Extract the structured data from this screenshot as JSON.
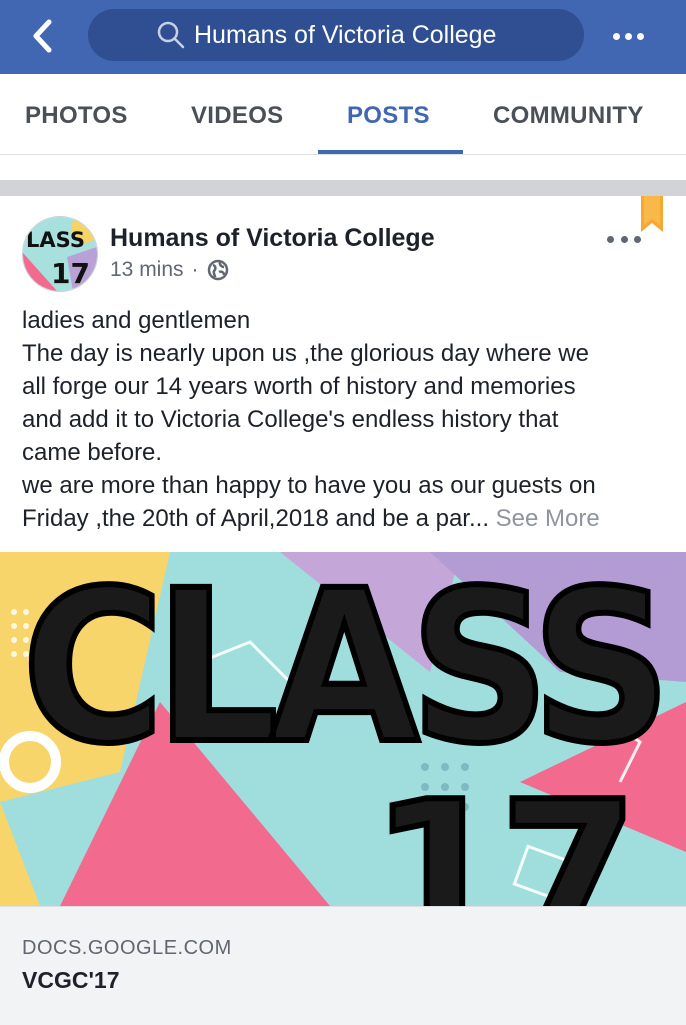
{
  "header": {
    "search_text": "Humans of Victoria College",
    "icons": {
      "back": "chevron-left-icon",
      "search": "search-icon",
      "more": "more-dots-icon"
    },
    "colors": {
      "bar": "#4267b2",
      "pill": "#2f4f92"
    }
  },
  "tabs": [
    {
      "label": "PHOTOS"
    },
    {
      "label": "VIDEOS"
    },
    {
      "label": "POSTS",
      "active": true
    },
    {
      "label": "COMMUNITY"
    }
  ],
  "post": {
    "page_name": "Humans of Victoria College",
    "time": "13 mins",
    "separator": "·",
    "privacy_icon": "globe-icon",
    "text_lines": [
      "ladies and gentlemen",
      "The day is nearly upon us ,the glorious day where we",
      "all forge our 14 years worth of history and memories",
      "and add it to Victoria College's endless history that",
      "came before.",
      "we are more than happy to have you as our guests  on",
      "Friday ,the 20th of April,2018 and be a par..."
    ],
    "see_more": "See More",
    "avatar_text": [
      "LASS",
      "17"
    ],
    "image_text": [
      "CLASS",
      "17"
    ],
    "link": {
      "domain": "DOCS.GOOGLE.COM",
      "title": "VCGC'17"
    }
  }
}
